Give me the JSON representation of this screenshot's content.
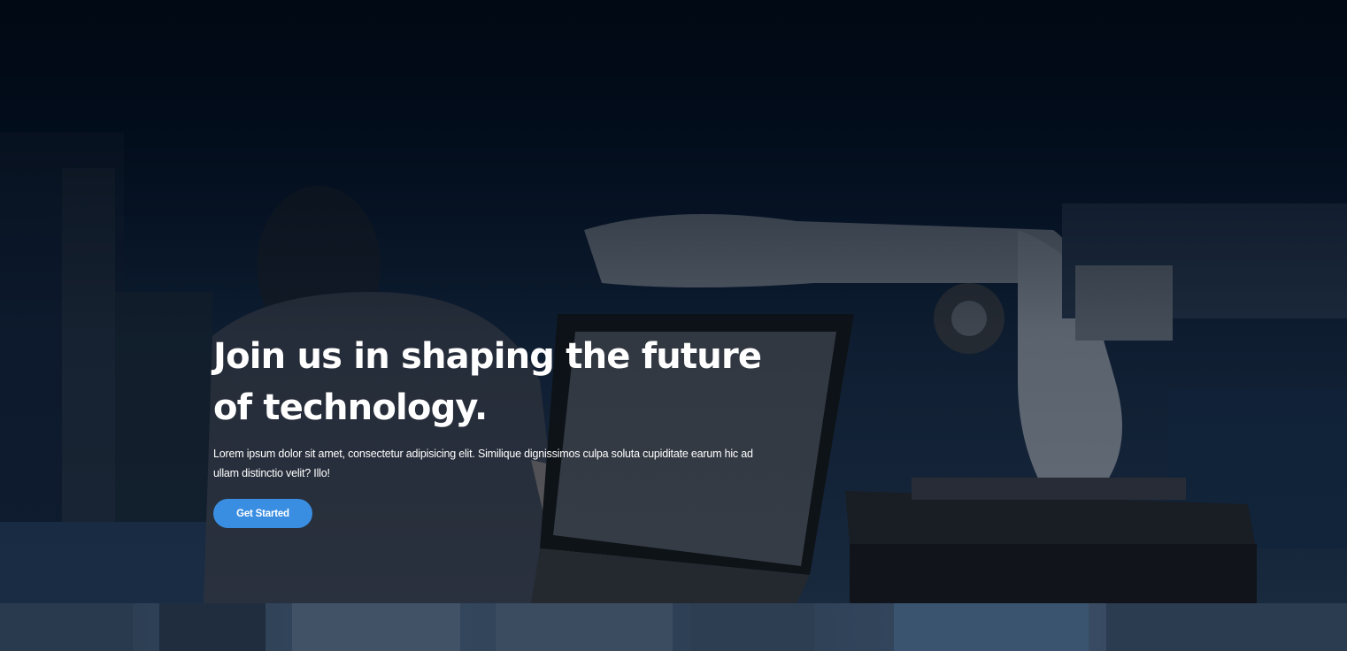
{
  "hero": {
    "headline": "Join us in shaping the future of technology.",
    "description": "Lorem ipsum dolor sit amet, consectetur adipisicing elit. Similique dignissimos culpa soluta cupiditate earum hic ad ullam distinctio velit? Illo!",
    "cta_label": "Get Started",
    "background_image": "person-operating-robot-arm-photo"
  },
  "colors": {
    "overlay": "#020b18",
    "accent": "#3a8ee2",
    "text": "#ffffff"
  }
}
